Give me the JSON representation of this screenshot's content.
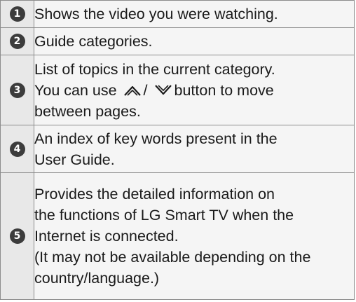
{
  "items": [
    {
      "number": "1",
      "lines": [
        "Shows the video you were watching."
      ]
    },
    {
      "number": "2",
      "lines": [
        "Guide categories."
      ]
    },
    {
      "number": "3",
      "line1": "List of topics in the current category.",
      "line2_before": "You can use",
      "line2_separator": "/",
      "line2_after": "button to move",
      "line3": "between pages.",
      "icons": [
        "chevron-up-icon",
        "chevron-down-icon"
      ]
    },
    {
      "number": "4",
      "lines": [
        "An index of key words present in the",
        "User Guide."
      ]
    },
    {
      "number": "5",
      "lines": [
        "Provides the detailed information on",
        "the functions of LG Smart TV when the",
        "Internet is connected.",
        "(It may not be available depending on the",
        "country/language.)"
      ]
    }
  ]
}
